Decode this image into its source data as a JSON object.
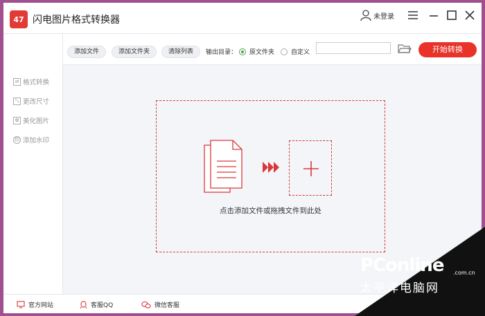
{
  "app": {
    "title": "闪电图片格式转换器",
    "logo_text": "47"
  },
  "user": {
    "label": "未登录"
  },
  "window_controls": {
    "icons": [
      "menu-icon",
      "minimize-icon",
      "maximize-icon",
      "close-icon"
    ]
  },
  "toolbar": {
    "add_file": "添加文件",
    "add_folder": "添加文件夹",
    "clear_list": "清除列表",
    "output_dir_label": "输出目录：",
    "radio_original": "原文件夹",
    "radio_custom": "自定义",
    "selected_output": "原文件夹",
    "path_value": "",
    "start_button": "开始转换"
  },
  "sidebar": {
    "items": [
      {
        "label": "格式转换",
        "icon": "convert-icon"
      },
      {
        "label": "更改尺寸",
        "icon": "resize-icon"
      },
      {
        "label": "美化图片",
        "icon": "beautify-icon"
      },
      {
        "label": "添加水印",
        "icon": "watermark-icon"
      }
    ]
  },
  "dropzone": {
    "hint": "点击添加文件或拖拽文件到此处"
  },
  "footer": {
    "links": [
      {
        "label": "官方网站",
        "icon": "monitor-icon"
      },
      {
        "label": "客服QQ",
        "icon": "qq-icon"
      },
      {
        "label": "微信客服",
        "icon": "wechat-icon"
      }
    ]
  },
  "watermark": {
    "brand": "PConline",
    "domain": ".com.cn",
    "subtitle": "太平洋电脑网"
  },
  "colors": {
    "accent": "#e8322a",
    "radio_selected": "#4aa14a",
    "background": "#f3f5f8"
  }
}
